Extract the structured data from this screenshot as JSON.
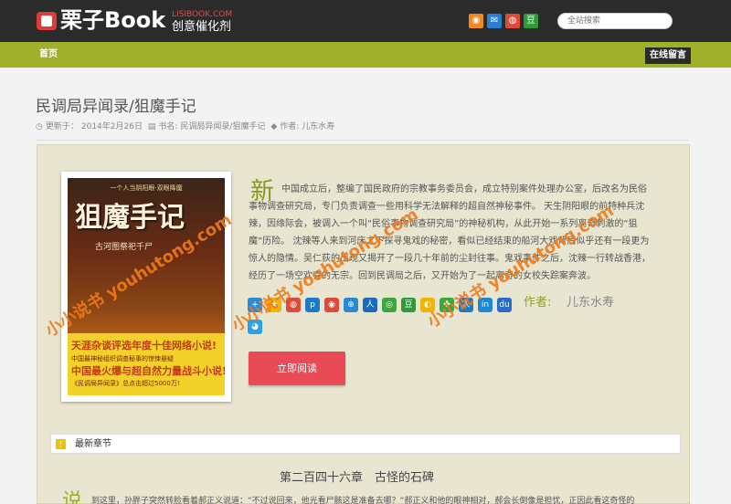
{
  "header": {
    "logo_main": "栗子Book",
    "logo_domain": "LISIBOOK.COM",
    "logo_tagline": "创意催化剂",
    "social": [
      {
        "name": "rss-icon",
        "glyph": "◉",
        "color": "#f08a20"
      },
      {
        "name": "mail-icon",
        "glyph": "✉",
        "color": "#2a7fd4"
      },
      {
        "name": "weibo-icon",
        "glyph": "◍",
        "color": "#e04a3a"
      },
      {
        "name": "douban-icon",
        "glyph": "豆",
        "color": "#2e9a3a"
      }
    ],
    "search_placeholder": "全站搜索"
  },
  "nav": {
    "home": "首页",
    "guestbook": "在线留言"
  },
  "book": {
    "title": "民调局异闻录/狙魔手记",
    "updated_label": "更新于：",
    "updated_date": "2014年2月26日",
    "bookname_label": "书名:",
    "bookname": "民调局异闻录/狙魔手记",
    "author_meta_label": "作者:",
    "author": "儿东水寿",
    "intro_dropcap": "新",
    "intro": "中国成立后，整编了国民政府的宗教事务委员会，成立特别案件处理办公室，后改名为民俗事物调查研究局，专门负责调查一些用科学无法解释的超自然神秘事件。 天生阴阳眼的前特种兵沈辣，因缘际会，被调入一个叫“民俗事物调查研究局”的神秘机构，从此开始一系列离奇刺激的“狙魔”历险。 沈辣等人来到河床之下探寻鬼戏的秘密，看似已经结束的船河大戏背后似乎还有一段更为惊人的隐情。吴仁荻的出现又揭开了一段几十年前的尘封往事。鬼戏事件之后，沈辣一行转战香港，经历了一场空欢喜的无宗。回到民调局之后，又开始为了一起离奇的女校失踪案奔波。",
    "author_label": "作者:",
    "read_button": "立即阅读",
    "cover": {
      "top_text": "一个人当阴阳眼·双眼降魔",
      "title": "狙魔手记",
      "subtitle": "古河图祭祀千尸",
      "band_line1": "天涯杂谈评选年度十佳网络小说!",
      "band_line2": "中国最神秘组织调查秘事的惊悚悬疑",
      "band_line3": "中国最火爆与超自然力量战斗小说!",
      "band_line4": "《民调局异闻录》总点击超过5000万!"
    }
  },
  "share_icons": [
    {
      "name": "share-more-icon",
      "glyph": "+",
      "color": "#2a8ad4"
    },
    {
      "name": "share-qzone-icon",
      "glyph": "★",
      "color": "#f2b400"
    },
    {
      "name": "share-weibo-icon",
      "glyph": "◍",
      "color": "#e04a3a"
    },
    {
      "name": "share-renren-icon",
      "glyph": "p",
      "color": "#1a7ac8"
    },
    {
      "name": "share-kaixin-icon",
      "glyph": "◉",
      "color": "#e04a3a"
    },
    {
      "name": "share-douban-icon",
      "glyph": "⊕",
      "color": "#2a8ad4"
    },
    {
      "name": "share-tqq-icon",
      "glyph": "人",
      "color": "#1a6ac0"
    },
    {
      "name": "share-wechat-icon",
      "glyph": "◎",
      "color": "#3aa83a"
    },
    {
      "name": "share-douban2-icon",
      "glyph": "豆",
      "color": "#2e9a3a"
    },
    {
      "name": "share-qq-icon",
      "glyph": "◐",
      "color": "#f2b400"
    },
    {
      "name": "share-clover-icon",
      "glyph": "✤",
      "color": "#3aa83a"
    },
    {
      "name": "share-renren2-icon",
      "glyph": "人",
      "color": "#1a7ac8"
    },
    {
      "name": "share-linkedin-icon",
      "glyph": "in",
      "color": "#1a8ad8"
    },
    {
      "name": "share-du-icon",
      "glyph": "du",
      "color": "#2a6ac8"
    },
    {
      "name": "share-qqchat-icon",
      "glyph": "◕",
      "color": "#2aa0e8"
    }
  ],
  "latest": {
    "label": "最新章节",
    "chapter_title": "第二百四十六章　古怪的石碑",
    "chapter_dropcap": "说",
    "chapter_text": "到这里，孙胖子突然转脸看着郝正义说道：“不过说回来，他光看尸骸这是准备去哪？”郝正义和他的眼神相对，郝会长倒像是担忧，正因此看这奇怪的"
  },
  "watermark": "小小说书 youhutong.com"
}
